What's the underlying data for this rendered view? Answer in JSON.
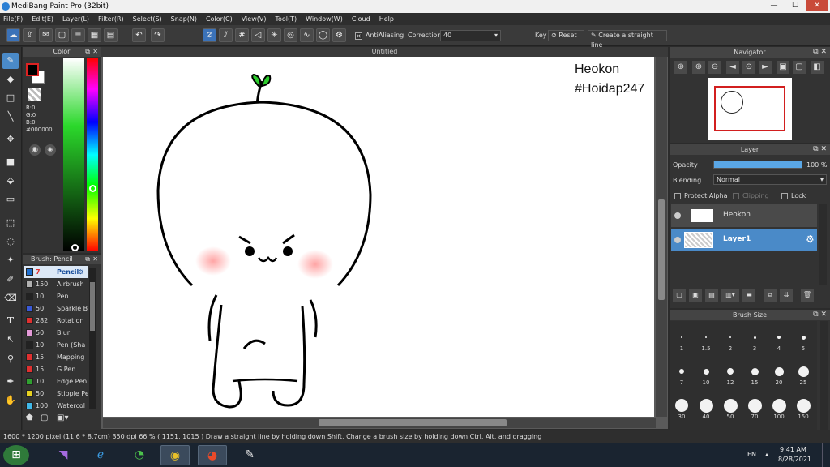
{
  "app": {
    "title": "MediBang Paint Pro (32bit)"
  },
  "window_controls": {
    "minimize": "—",
    "maximize": "☐",
    "close": "✕"
  },
  "menu": [
    "File(F)",
    "Edit(E)",
    "Layer(L)",
    "Filter(R)",
    "Select(S)",
    "Snap(N)",
    "Color(C)",
    "View(V)",
    "Tool(T)",
    "Window(W)",
    "Cloud",
    "Help"
  ],
  "toolbar": {
    "antialiasing_label": "AntiAliasing",
    "correction_label": "Correction",
    "correction_value": "40",
    "key_label": "Key",
    "reset_label": "Reset",
    "straight_line_label": "Create a straight line"
  },
  "color_panel": {
    "title": "Color",
    "r": "R:0",
    "g": "G:0",
    "b": "B:0",
    "hex": "#000000",
    "primary_color": "#000000",
    "secondary_color": "#ffffff"
  },
  "brush_panel": {
    "title": "Brush: Pencil",
    "brushes": [
      {
        "size": "7",
        "name": "Pencil",
        "color": "#1e6fd0",
        "selected": true
      },
      {
        "size": "150",
        "name": "Airbrush",
        "color": "#b0b0b0",
        "selected": false
      },
      {
        "size": "10",
        "name": "Pen",
        "color": "#222222",
        "selected": false
      },
      {
        "size": "50",
        "name": "Sparkle B",
        "color": "#3a5ad8",
        "selected": false
      },
      {
        "size": "282",
        "name": "Rotation",
        "color": "#e03030",
        "selected": false
      },
      {
        "size": "50",
        "name": "Blur",
        "color": "#e49ad8",
        "selected": false
      },
      {
        "size": "10",
        "name": "Pen (Sha",
        "color": "#222222",
        "selected": false
      },
      {
        "size": "15",
        "name": "Mapping",
        "color": "#e03030",
        "selected": false
      },
      {
        "size": "15",
        "name": "G Pen",
        "color": "#e03030",
        "selected": false
      },
      {
        "size": "10",
        "name": "Edge Pen",
        "color": "#30a030",
        "selected": false
      },
      {
        "size": "50",
        "name": "Stipple Pe",
        "color": "#e6d020",
        "selected": false
      },
      {
        "size": "100",
        "name": "Watercol",
        "color": "#40b8e8",
        "selected": false
      }
    ]
  },
  "document": {
    "title": "Untitled",
    "annotation_line1": "Heokon",
    "annotation_line2": "#Hoidap247"
  },
  "navigator": {
    "title": "Navigator"
  },
  "layer_panel": {
    "title": "Layer",
    "opacity_label": "Opacity",
    "opacity_value": "100 %",
    "opacity": 1.0,
    "blending_label": "Blending",
    "blending_value": "Normal",
    "protect_alpha": "Protect Alpha",
    "clipping": "Clipping",
    "lock": "Lock",
    "layers": [
      {
        "name": "Heokon",
        "selected": false
      },
      {
        "name": "Layer1",
        "selected": true
      }
    ]
  },
  "brush_size_panel": {
    "title": "Brush Size",
    "sizes": [
      "1",
      "1.5",
      "2",
      "3",
      "4",
      "5",
      "7",
      "10",
      "12",
      "15",
      "20",
      "25",
      "30",
      "40",
      "50",
      "70",
      "100",
      "150"
    ]
  },
  "status_bar": {
    "dimensions": "1600 * 1200 pixel",
    "physical_size": "(11.6 * 8.7cm)",
    "dpi": "350 dpi",
    "zoom": "66 %",
    "coords": "( 1151, 1015 )",
    "hint": "Draw a straight line by holding down Shift, Change a brush size by holding down Ctrl, Alt, and dragging"
  },
  "taskbar": {
    "language": "EN",
    "time": "9:41 AM",
    "date": "8/28/2021"
  }
}
